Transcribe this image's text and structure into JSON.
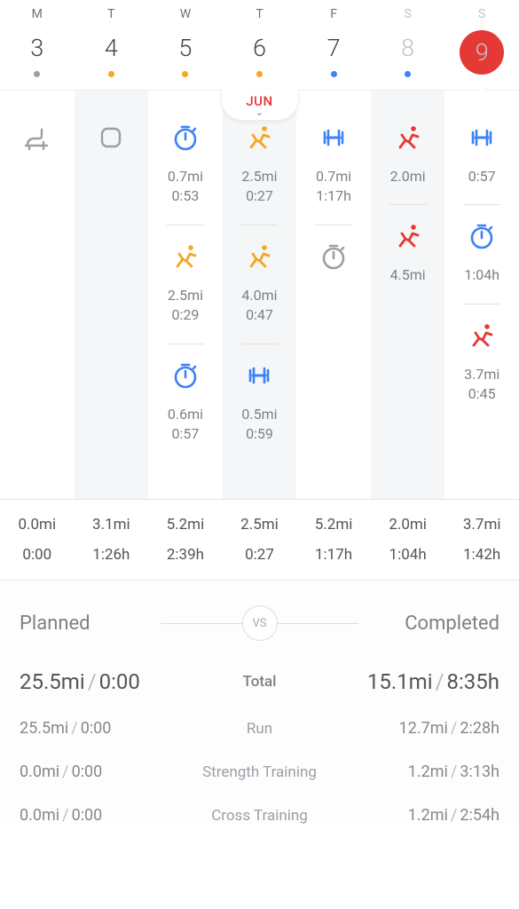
{
  "calendar": {
    "month": "JUN",
    "days": [
      {
        "dow": "M",
        "num": "3",
        "dotClass": "dot-grey",
        "muted": false,
        "circled": false
      },
      {
        "dow": "T",
        "num": "4",
        "dotClass": "dot-orange",
        "muted": false,
        "circled": false
      },
      {
        "dow": "W",
        "num": "5",
        "dotClass": "dot-orange",
        "muted": false,
        "circled": false
      },
      {
        "dow": "T",
        "num": "6",
        "dotClass": "dot-orange",
        "muted": false,
        "circled": false
      },
      {
        "dow": "F",
        "num": "7",
        "dotClass": "dot-blue",
        "muted": false,
        "circled": false
      },
      {
        "dow": "S",
        "num": "8",
        "dotClass": "dot-blue",
        "muted": true,
        "circled": false
      },
      {
        "dow": "S",
        "num": "9",
        "dotClass": "dot-white",
        "muted": true,
        "circled": true
      }
    ]
  },
  "columns": [
    {
      "slots": [
        {
          "icon": "rest",
          "color": "grey",
          "l1": "",
          "l2": ""
        }
      ]
    },
    {
      "slots": [
        {
          "icon": "track",
          "color": "grey",
          "l1": "",
          "l2": ""
        }
      ]
    },
    {
      "slots": [
        {
          "icon": "timer",
          "color": "blue",
          "l1": "0.7mi",
          "l2": "0:53"
        },
        {
          "icon": "run",
          "color": "orange",
          "l1": "2.5mi",
          "l2": "0:29"
        },
        {
          "icon": "timer",
          "color": "blue",
          "l1": "0.6mi",
          "l2": "0:57"
        }
      ]
    },
    {
      "slots": [
        {
          "icon": "run",
          "color": "orange",
          "l1": "2.5mi",
          "l2": "0:27"
        },
        {
          "icon": "run",
          "color": "orange",
          "l1": "4.0mi",
          "l2": "0:47"
        },
        {
          "icon": "dumbbell",
          "color": "blue",
          "l1": "0.5mi",
          "l2": "0:59"
        }
      ]
    },
    {
      "slots": [
        {
          "icon": "dumbbell",
          "color": "blue",
          "l1": "0.7mi",
          "l2": "1:17h"
        },
        {
          "icon": "timer",
          "color": "grey",
          "l1": "",
          "l2": ""
        }
      ]
    },
    {
      "slots": [
        {
          "icon": "run",
          "color": "red",
          "l1": "2.0mi",
          "l2": ""
        },
        {
          "icon": "run",
          "color": "red",
          "l1": "4.5mi",
          "l2": ""
        }
      ]
    },
    {
      "slots": [
        {
          "icon": "dumbbell",
          "color": "blue",
          "l1": "",
          "l2": "0:57"
        },
        {
          "icon": "timer",
          "color": "blue",
          "l1": "",
          "l2": "1:04h"
        }
      ]
    },
    {
      "slots": [
        {
          "icon": "run",
          "color": "red",
          "l1": "3.7mi",
          "l2": "0:45"
        }
      ],
      "col8": true
    }
  ],
  "col8_slot": {
    "icon": "run",
    "color": "red",
    "l1": "3.7mi",
    "l2": "0:45"
  },
  "summary": [
    {
      "dist": "0.0mi",
      "time": "0:00"
    },
    {
      "dist": "3.1mi",
      "time": "1:26h"
    },
    {
      "dist": "5.2mi",
      "time": "2:39h"
    },
    {
      "dist": "2.5mi",
      "time": "0:27"
    },
    {
      "dist": "5.2mi",
      "time": "1:17h"
    },
    {
      "dist": "2.0mi",
      "time": "1:04h"
    },
    {
      "dist": "3.7mi",
      "time": "1:42h"
    }
  ],
  "pvc": {
    "planned_label": "Planned",
    "completed_label": "Completed",
    "vs": "vs",
    "rows": [
      {
        "pl": "25.5mi",
        "pt": "0:00",
        "label": "Total",
        "cl": "15.1mi",
        "ct": "8:35h",
        "total": true
      },
      {
        "pl": "25.5mi",
        "pt": "0:00",
        "label": "Run",
        "cl": "12.7mi",
        "ct": "2:28h",
        "total": false
      },
      {
        "pl": "0.0mi",
        "pt": "0:00",
        "label": "Strength Training",
        "cl": "1.2mi",
        "ct": "3:13h",
        "total": false
      },
      {
        "pl": "0.0mi",
        "pt": "0:00",
        "label": "Cross Training",
        "cl": "1.2mi",
        "ct": "2:54h",
        "total": false
      }
    ]
  }
}
